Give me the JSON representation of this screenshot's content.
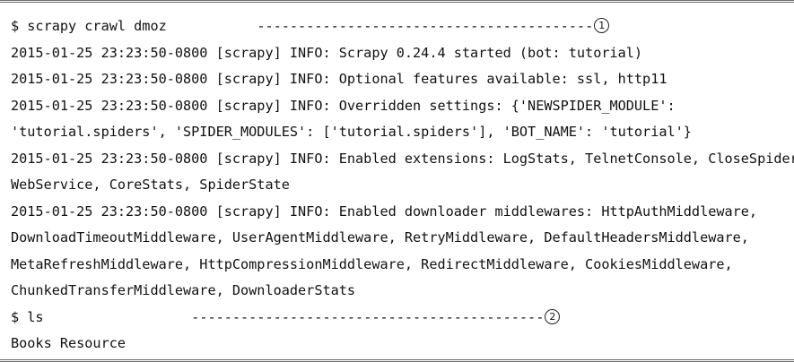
{
  "terminal": {
    "command1": {
      "prompt": "$ scrapy crawl dmoz",
      "padding": "           ",
      "dashes": "-----------------------------------------",
      "marker": "1"
    },
    "output1": [
      "2015-01-25 23:23:50-0800 [scrapy] INFO: Scrapy 0.24.4 started (bot: tutorial)",
      "2015-01-25 23:23:50-0800 [scrapy] INFO: Optional features available: ssl, http11",
      "2015-01-25 23:23:50-0800 [scrapy] INFO: Overridden settings: {'NEWSPIDER_MODULE':",
      "'tutorial.spiders', 'SPIDER_MODULES': ['tutorial.spiders'], 'BOT_NAME': 'tutorial'}",
      "2015-01-25 23:23:50-0800 [scrapy] INFO: Enabled extensions: LogStats, TelnetConsole, CloseSpider,",
      "WebService, CoreStats, SpiderState",
      "2015-01-25 23:23:50-0800 [scrapy] INFO: Enabled downloader middlewares: HttpAuthMiddleware,",
      "DownloadTimeoutMiddleware, UserAgentMiddleware, RetryMiddleware, DefaultHeadersMiddleware,",
      "MetaRefreshMiddleware, HttpCompressionMiddleware, RedirectMiddleware, CookiesMiddleware,",
      "ChunkedTransferMiddleware, DownloaderStats"
    ],
    "command2": {
      "prompt": "$ ls",
      "padding": "                  ",
      "dashes": "-------------------------------------------",
      "marker": "2"
    },
    "output2": [
      "Books Resource"
    ]
  }
}
